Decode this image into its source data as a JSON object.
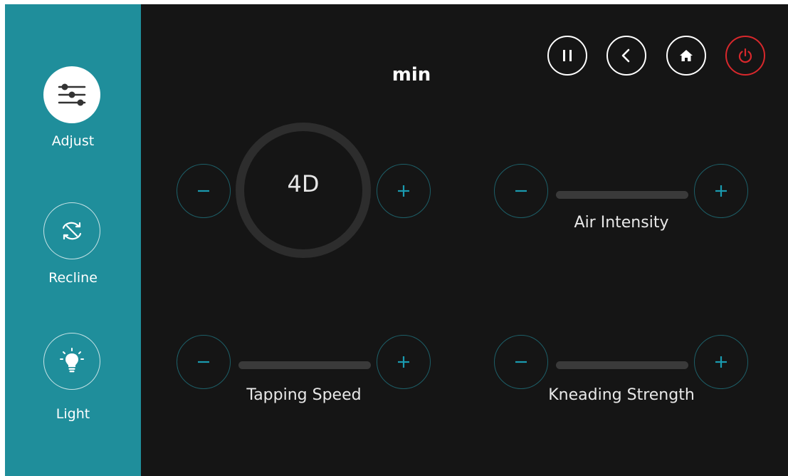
{
  "sidebar": {
    "items": [
      {
        "label": "Adjust",
        "icon": "sliders-icon",
        "active": true
      },
      {
        "label": "Recline",
        "icon": "recline-icon",
        "active": false
      },
      {
        "label": "Light",
        "icon": "lightbulb-icon",
        "active": false
      }
    ]
  },
  "header": {
    "title": "min",
    "buttons": [
      {
        "icon": "pause-icon"
      },
      {
        "icon": "back-icon"
      },
      {
        "icon": "home-icon"
      },
      {
        "icon": "power-icon"
      }
    ]
  },
  "controls": {
    "mode": {
      "label": "4D"
    },
    "air_intensity": {
      "label": "Air Intensity"
    },
    "tapping_speed": {
      "label": "Tapping Speed"
    },
    "kneading_strength": {
      "label": "Kneading Strength"
    }
  },
  "colors": {
    "sidebar_bg": "#1f8e9b",
    "main_bg": "#151515",
    "accent": "#1a9bb0",
    "power": "#d8282c"
  }
}
